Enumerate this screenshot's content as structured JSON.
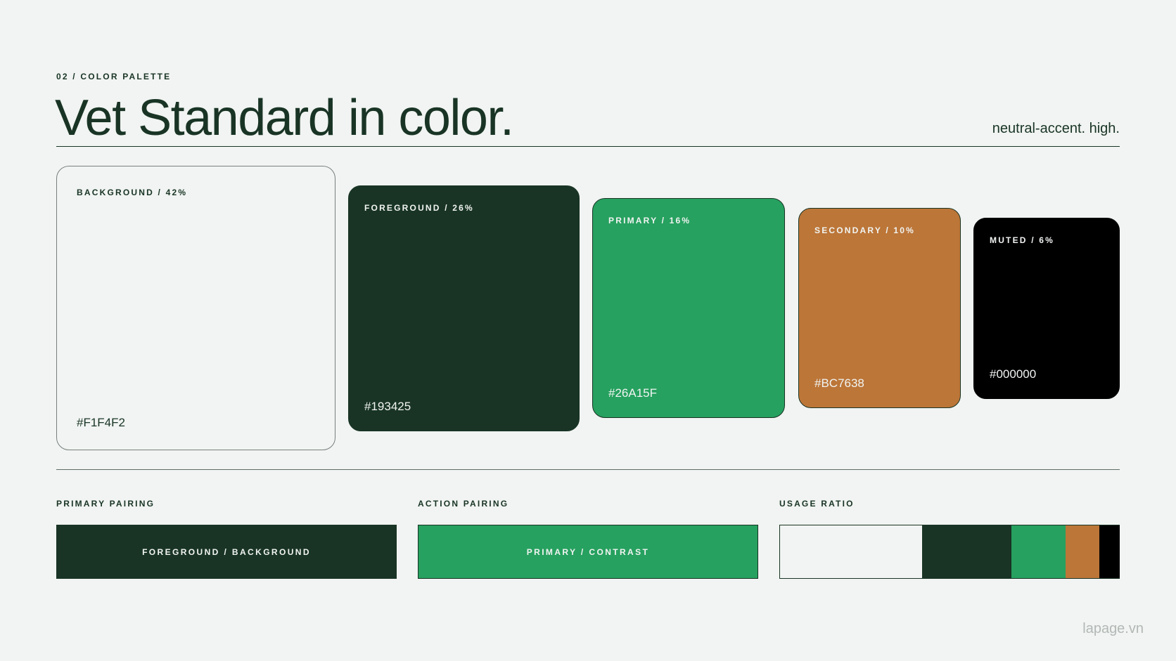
{
  "header": {
    "eyebrow": "02 / COLOR PALETTE",
    "title": "Vet Standard in color.",
    "tagline": "neutral-accent. high."
  },
  "swatches": [
    {
      "label": "BACKGROUND / 42%",
      "hex": "#F1F4F2",
      "color": "#F1F4F2",
      "text_color": "#193425",
      "percent": 42
    },
    {
      "label": "FOREGROUND / 26%",
      "hex": "#193425",
      "color": "#193425",
      "text_color": "#F1F4F2",
      "percent": 26
    },
    {
      "label": "PRIMARY / 16%",
      "hex": "#26A15F",
      "color": "#26A15F",
      "text_color": "#F1F4F2",
      "percent": 16
    },
    {
      "label": "SECONDARY / 10%",
      "hex": "#BC7638",
      "color": "#BC7638",
      "text_color": "#F1F4F2",
      "percent": 10
    },
    {
      "label": "MUTED / 6%",
      "hex": "#000000",
      "color": "#000000",
      "text_color": "#F1F4F2",
      "percent": 6
    }
  ],
  "pairings": {
    "primary": {
      "heading": "PRIMARY PAIRING",
      "label": "FOREGROUND / BACKGROUND",
      "bg": "#193425",
      "fg": "#F1F4F2"
    },
    "action": {
      "heading": "ACTION PAIRING",
      "label": "PRIMARY / CONTRAST",
      "bg": "#26A15F",
      "fg": "#F1F4F2"
    },
    "usage": {
      "heading": "USAGE RATIO",
      "segments": [
        {
          "color": "#F1F4F2",
          "percent": 42
        },
        {
          "color": "#193425",
          "percent": 26
        },
        {
          "color": "#26A15F",
          "percent": 16
        },
        {
          "color": "#BC7638",
          "percent": 10
        },
        {
          "color": "#000000",
          "percent": 6
        }
      ]
    }
  },
  "footer": {
    "watermark": "lapage.vn"
  }
}
